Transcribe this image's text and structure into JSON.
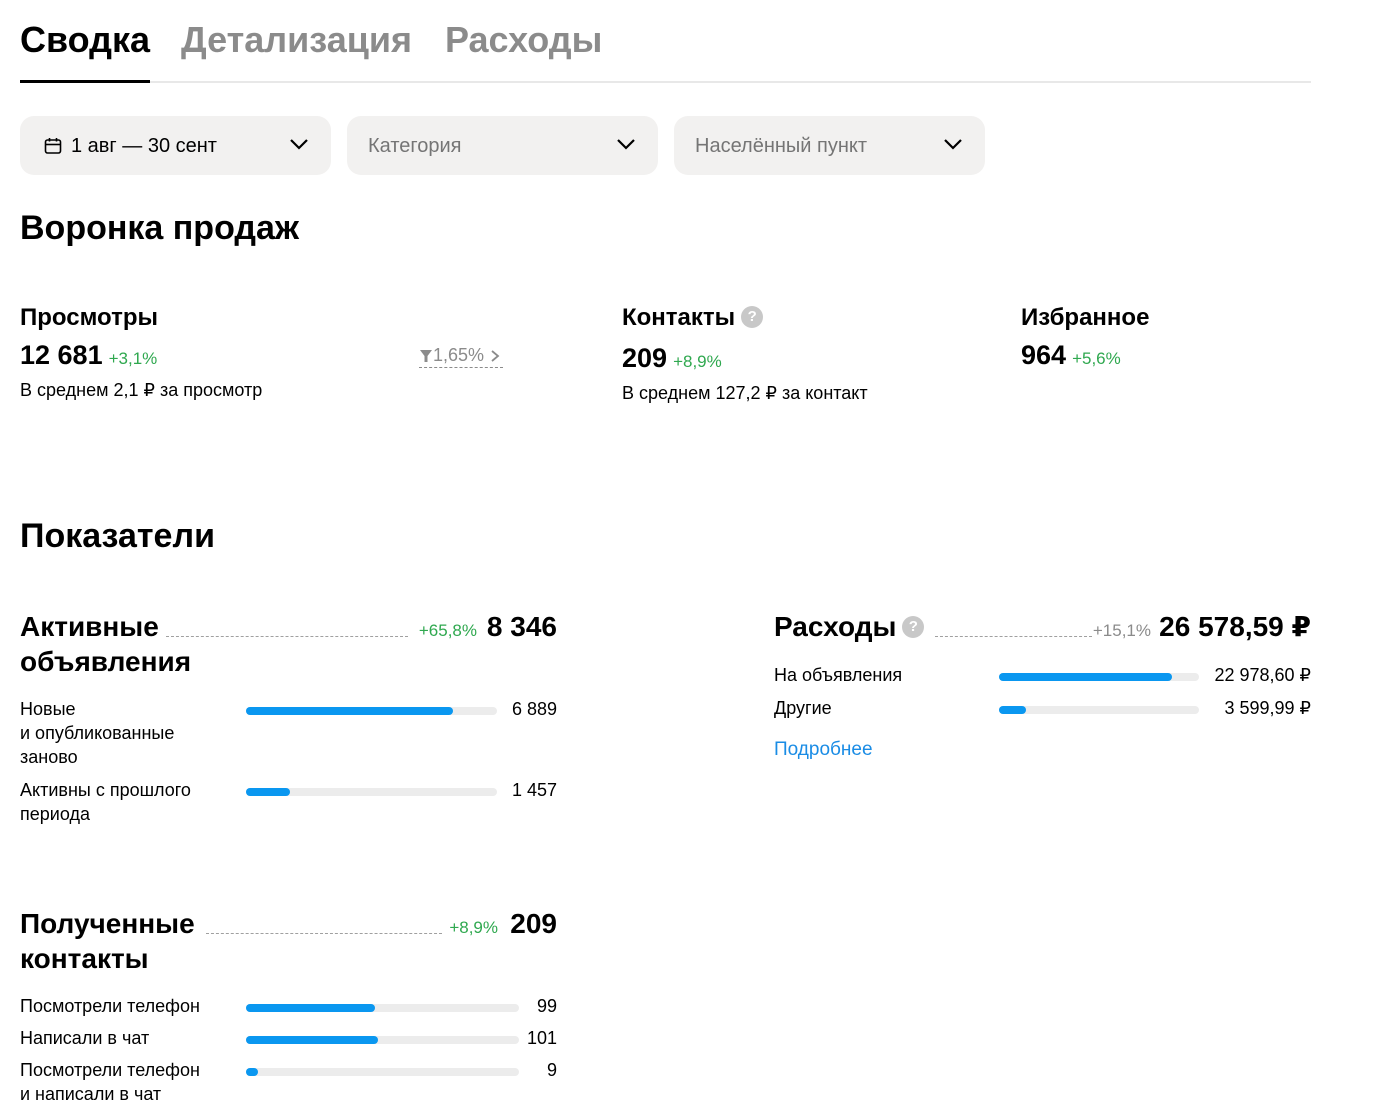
{
  "tabs": [
    {
      "label": "Сводка",
      "active": true
    },
    {
      "label": "Детализация",
      "active": false
    },
    {
      "label": "Расходы",
      "active": false
    }
  ],
  "filters": {
    "period": "1 авг — 30 сент",
    "category_placeholder": "Категория",
    "location_placeholder": "Населённый пункт"
  },
  "funnel": {
    "title": "Воронка продаж",
    "views": {
      "title": "Просмотры",
      "value": "12 681",
      "delta": "+3,1%",
      "sub": "В среднем 2,1 ₽ за просмотр"
    },
    "conversion": "1,65%",
    "contacts": {
      "title": "Контакты",
      "value": "209",
      "delta": "+8,9%",
      "sub": "В среднем 127,2 ₽ за контакт"
    },
    "favorites": {
      "title": "Избранное",
      "value": "964",
      "delta": "+5,6%"
    }
  },
  "indicators": {
    "title": "Показатели",
    "active_ads": {
      "title_line1": "Активные",
      "title_line2": "объявления",
      "delta": "+65,8%",
      "total": "8 346",
      "rows": [
        {
          "label1": "Новые",
          "label2": "и опубликованные",
          "label3": "заново",
          "value": "6 889",
          "fraction": 0.825
        },
        {
          "label1": "Активны с прошлого",
          "label2": "периода",
          "value": "1 457",
          "fraction": 0.175
        }
      ]
    },
    "expenses": {
      "title": "Расходы",
      "delta": "+15,1%",
      "total": "26 578,59 ₽",
      "rows": [
        {
          "label": "На объявления",
          "value": "22 978,60 ₽",
          "fraction": 0.865
        },
        {
          "label": "Другие",
          "value": "3 599,99 ₽",
          "fraction": 0.135
        }
      ],
      "more_link": "Подробнее"
    },
    "contacts": {
      "title_line1": "Полученные",
      "title_line2": "контакты",
      "delta": "+8,9%",
      "total": "209",
      "rows": [
        {
          "label1": "Посмотрели телефон",
          "value": "99",
          "fraction": 0.474
        },
        {
          "label1": "Написали в чат",
          "value": "101",
          "fraction": 0.483
        },
        {
          "label1": "Посмотрели телефон",
          "label2": "и написали в чат",
          "value": "9",
          "fraction": 0.043
        }
      ]
    }
  }
}
